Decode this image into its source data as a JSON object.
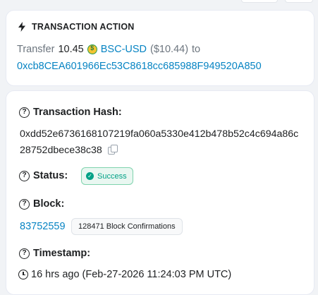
{
  "action": {
    "title": "TRANSACTION ACTION",
    "transfer_word": "Transfer",
    "amount": "10.45",
    "token": "BSC-USD",
    "usd_value": "($10.44)",
    "to_word": "to",
    "to_address": "0xcb8CEA601966Ec53C8618cc685988F949520A850"
  },
  "details": {
    "hash_label": "Transaction Hash:",
    "hash_value": "0xdd52e6736168107219fa060a5330e412b478b52c4c694a86c28752dbece38c38",
    "status_label": "Status:",
    "status_value": "Success",
    "block_label": "Block:",
    "block_number": "83752559",
    "block_confirmations": "128471 Block Confirmations",
    "timestamp_label": "Timestamp:",
    "timestamp_value": "16 hrs ago (Feb-27-2026 11:24:03 PM UTC)"
  },
  "icons": {
    "action": "lightning-bolt-icon",
    "token": "bsc-usd-coin-icon",
    "help": "question-circle-icon",
    "copy": "copy-icon",
    "status": "check-circle-icon",
    "time": "clock-icon"
  },
  "colors": {
    "link": "#0784c3",
    "success": "#00a186",
    "text": "#1e2022",
    "muted": "#6c757e"
  }
}
